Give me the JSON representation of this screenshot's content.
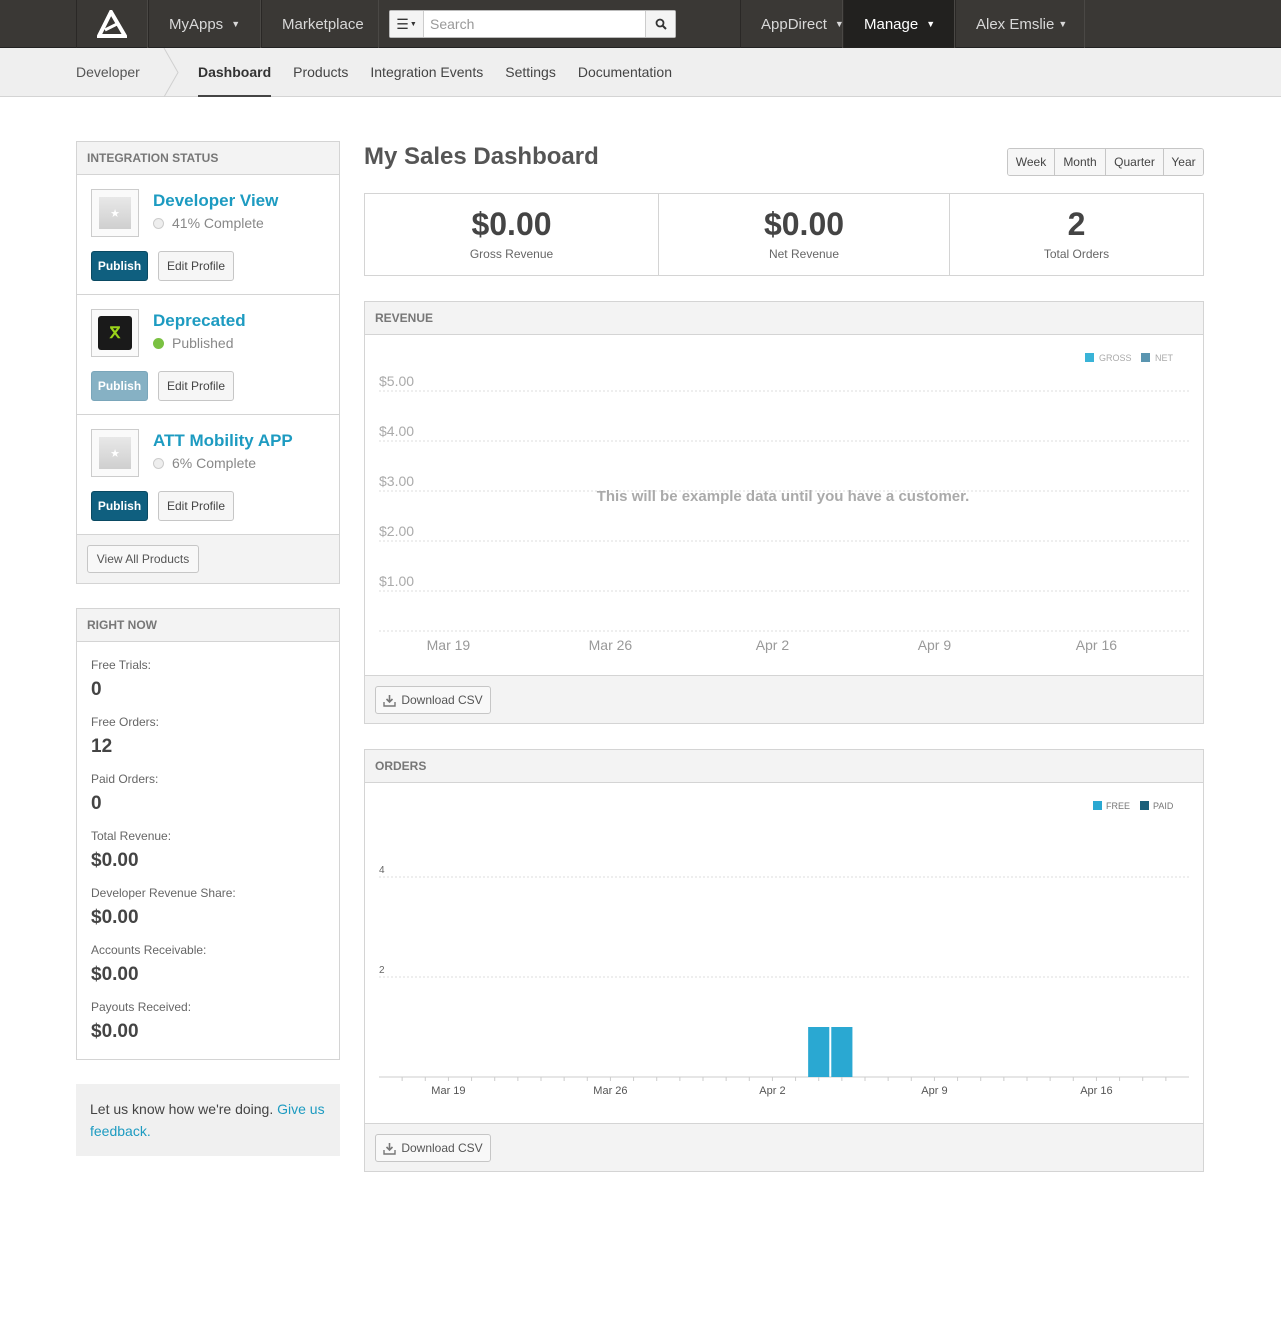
{
  "topnav": {
    "myapps": "MyApps",
    "marketplace": "Marketplace",
    "search_placeholder": "Search",
    "appdirect": "AppDirect",
    "manage": "Manage",
    "user": "Alex Emslie"
  },
  "subnav": {
    "section": "Developer",
    "tabs": [
      "Dashboard",
      "Products",
      "Integration Events",
      "Settings",
      "Documentation"
    ],
    "active": "Dashboard"
  },
  "integration": {
    "title": "INTEGRATION STATUS",
    "products": [
      {
        "name": "Developer View",
        "status": "41% Complete",
        "status_kind": "incomplete",
        "icon": "star-placeholder-icon",
        "publish": "Publish",
        "publish_enabled": true,
        "edit": "Edit Profile"
      },
      {
        "name": "Deprecated",
        "status": "Published",
        "status_kind": "published",
        "icon": "app-logo-icon",
        "publish": "Publish",
        "publish_enabled": false,
        "edit": "Edit Profile"
      },
      {
        "name": "ATT Mobility APP",
        "status": "6% Complete",
        "status_kind": "incomplete",
        "icon": "star-placeholder-icon",
        "publish": "Publish",
        "publish_enabled": true,
        "edit": "Edit Profile"
      }
    ],
    "view_all": "View All Products"
  },
  "right_now": {
    "title": "RIGHT NOW",
    "items": [
      {
        "label": "Free Trials:",
        "value": "0"
      },
      {
        "label": "Free Orders:",
        "value": "12"
      },
      {
        "label": "Paid Orders:",
        "value": "0"
      },
      {
        "label": "Total Revenue:",
        "value": "$0.00"
      },
      {
        "label": "Developer Revenue Share:",
        "value": "$0.00"
      },
      {
        "label": "Accounts Receivable:",
        "value": "$0.00"
      },
      {
        "label": "Payouts Received:",
        "value": "$0.00"
      }
    ]
  },
  "feedback": {
    "text": "Let us know how we're doing. ",
    "link": "Give us feedback."
  },
  "dashboard": {
    "title": "My Sales Dashboard",
    "ranges": [
      "Week",
      "Month",
      "Quarter",
      "Year"
    ],
    "stats": [
      {
        "value": "$0.00",
        "label": "Gross Revenue"
      },
      {
        "value": "$0.00",
        "label": "Net Revenue"
      },
      {
        "value": "2",
        "label": "Total Orders"
      }
    ],
    "download_csv": "Download CSV"
  },
  "colors": {
    "gross": "#39b3d7",
    "net": "#5a95b0",
    "free": "#2aa8d2",
    "paid": "#1a5f7a",
    "link": "#1d9bc1"
  },
  "chart_data": [
    {
      "type": "line",
      "title": "REVENUE",
      "legend": [
        "GROSS",
        "NET"
      ],
      "legend_position": "top-right",
      "y_ticks": [
        "$5.00",
        "$4.00",
        "$3.00",
        "$2.00",
        "$1.00"
      ],
      "x_ticks": [
        "Mar 19",
        "Mar 26",
        "Apr 2",
        "Apr 9",
        "Apr 16"
      ],
      "ylim": [
        0,
        5
      ],
      "grid": true,
      "series": [],
      "annotation": "This will be example data until you have a customer."
    },
    {
      "type": "bar",
      "title": "ORDERS",
      "legend": [
        "FREE",
        "PAID"
      ],
      "legend_position": "top-right",
      "y_ticks": [
        "4",
        "2"
      ],
      "x_ticks": [
        "Mar 19",
        "Mar 26",
        "Apr 2",
        "Apr 9",
        "Apr 16"
      ],
      "ylim": [
        0,
        4
      ],
      "grid": true,
      "series": [
        {
          "name": "FREE",
          "x": [
            "Apr 4",
            "Apr 5"
          ],
          "values": [
            1,
            1
          ]
        }
      ]
    }
  ]
}
